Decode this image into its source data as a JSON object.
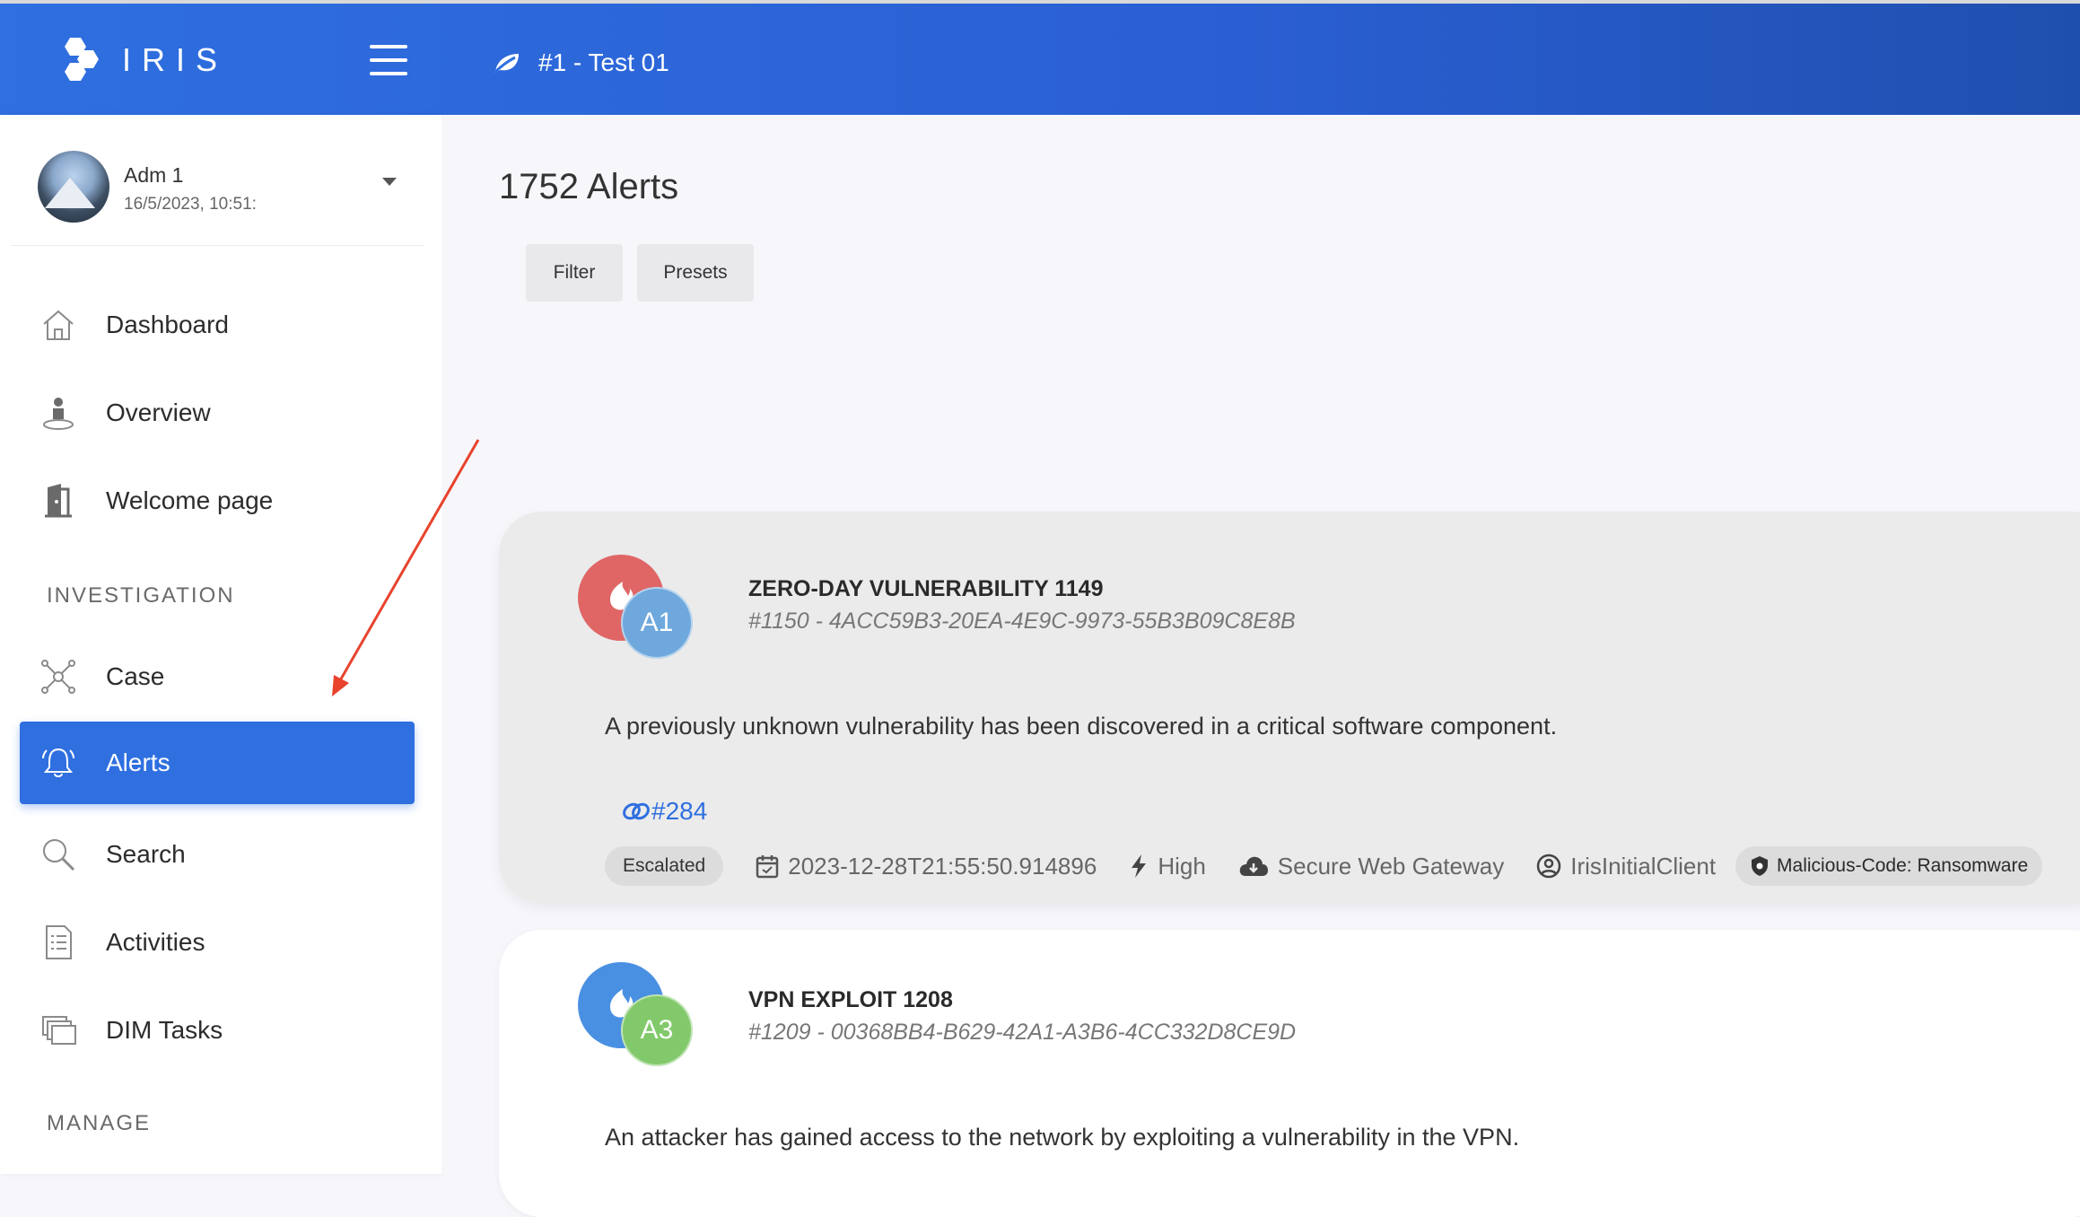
{
  "header": {
    "app_name": "IRIS",
    "case_title": "#1 - Test 01"
  },
  "user": {
    "name": "Adm 1",
    "timestamp": "16/5/2023, 10:51:"
  },
  "sidebar": {
    "items": [
      {
        "label": "Dashboard",
        "icon": "home-icon"
      },
      {
        "label": "Overview",
        "icon": "person-pin-icon"
      },
      {
        "label": "Welcome page",
        "icon": "door-icon"
      }
    ],
    "section_investigation": "INVESTIGATION",
    "investigation_items": [
      {
        "label": "Case",
        "icon": "network-icon"
      },
      {
        "label": "Alerts",
        "icon": "bell-icon",
        "active": true
      },
      {
        "label": "Search",
        "icon": "search-icon"
      },
      {
        "label": "Activities",
        "icon": "document-icon"
      },
      {
        "label": "DIM Tasks",
        "icon": "stack-icon"
      }
    ],
    "section_manage": "MANAGE"
  },
  "main": {
    "title": "1752 Alerts",
    "buttons": {
      "filter": "Filter",
      "presets": "Presets"
    },
    "alerts": [
      {
        "title": "ZERO-DAY VULNERABILITY 1149",
        "id": "#1150 - 4ACC59B3-20EA-4E9C-9973-55B3B09C8E8B",
        "assignee": "A1",
        "description": "A previously unknown vulnerability has been discovered in a critical software component.",
        "linked_case": "#284",
        "status": "Escalated",
        "date": "2023-12-28T21:55:50.914896",
        "severity": "High",
        "source": "Secure Web Gateway",
        "client": "IrisInitialClient",
        "classification": "Malicious-Code: Ransomware",
        "colors": {
          "main": "#e06666",
          "sub": "#6fa8dc"
        }
      },
      {
        "title": "VPN EXPLOIT 1208",
        "id": "#1209 - 00368BB4-B629-42A1-A3B6-4CC332D8CE9D",
        "assignee": "A3",
        "description": "An attacker has gained access to the network by exploiting a vulnerability in the VPN.",
        "colors": {
          "main": "#4a90e2",
          "sub": "#82c96b"
        }
      }
    ]
  },
  "annotation": {
    "arrow_color": "#e8432d"
  }
}
